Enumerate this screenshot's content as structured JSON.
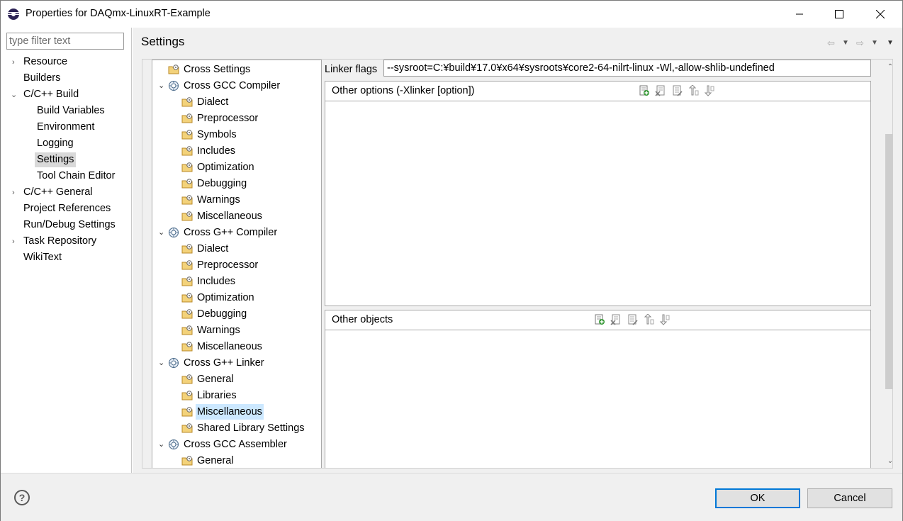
{
  "window": {
    "title": "Properties for DAQmx-LinuxRT-Example"
  },
  "filter": {
    "placeholder": "type filter text"
  },
  "nav": {
    "items": [
      {
        "label": "Resource"
      },
      {
        "label": "Builders"
      },
      {
        "label": "C/C++ Build"
      },
      {
        "label": "Build Variables"
      },
      {
        "label": "Environment"
      },
      {
        "label": "Logging"
      },
      {
        "label": "Settings",
        "selected": true
      },
      {
        "label": "Tool Chain Editor"
      },
      {
        "label": "C/C++ General"
      },
      {
        "label": "Project References"
      },
      {
        "label": "Run/Debug Settings"
      },
      {
        "label": "Task Repository"
      },
      {
        "label": "WikiText"
      }
    ]
  },
  "page": {
    "title": "Settings"
  },
  "tree": {
    "rows": [
      {
        "label": "Cross Settings",
        "icon": "folder-settings-icon"
      },
      {
        "label": "Cross GCC Compiler",
        "icon": "tool-gear-icon",
        "expanded": true
      },
      {
        "label": "Dialect",
        "icon": "folder-settings-icon"
      },
      {
        "label": "Preprocessor",
        "icon": "folder-settings-icon"
      },
      {
        "label": "Symbols",
        "icon": "folder-settings-icon"
      },
      {
        "label": "Includes",
        "icon": "folder-settings-icon"
      },
      {
        "label": "Optimization",
        "icon": "folder-settings-icon"
      },
      {
        "label": "Debugging",
        "icon": "folder-settings-icon"
      },
      {
        "label": "Warnings",
        "icon": "folder-settings-icon"
      },
      {
        "label": "Miscellaneous",
        "icon": "folder-settings-icon"
      },
      {
        "label": "Cross G++ Compiler",
        "icon": "tool-gear-icon",
        "expanded": true
      },
      {
        "label": "Dialect",
        "icon": "folder-settings-icon"
      },
      {
        "label": "Preprocessor",
        "icon": "folder-settings-icon"
      },
      {
        "label": "Includes",
        "icon": "folder-settings-icon"
      },
      {
        "label": "Optimization",
        "icon": "folder-settings-icon"
      },
      {
        "label": "Debugging",
        "icon": "folder-settings-icon"
      },
      {
        "label": "Warnings",
        "icon": "folder-settings-icon"
      },
      {
        "label": "Miscellaneous",
        "icon": "folder-settings-icon"
      },
      {
        "label": "Cross G++ Linker",
        "icon": "tool-gear-icon",
        "expanded": true
      },
      {
        "label": "General",
        "icon": "folder-settings-icon"
      },
      {
        "label": "Libraries",
        "icon": "folder-settings-icon"
      },
      {
        "label": "Miscellaneous",
        "icon": "folder-settings-icon",
        "selected": true
      },
      {
        "label": "Shared Library Settings",
        "icon": "folder-settings-icon"
      },
      {
        "label": "Cross GCC Assembler",
        "icon": "tool-gear-icon",
        "expanded": true
      },
      {
        "label": "General",
        "icon": "folder-settings-icon"
      }
    ]
  },
  "details": {
    "linker_flags_label": "Linker flags",
    "linker_flags_value": "--sysroot=C:¥build¥17.0¥x64¥sysroots¥core2-64-nilrt-linux -Wl,-allow-shlib-undefined",
    "other_options_title": "Other options (-Xlinker [option])",
    "other_objects_title": "Other objects"
  },
  "buttons": {
    "ok": "OK",
    "cancel": "Cancel"
  },
  "colors": {
    "selection_tree": "#cce8ff",
    "selection_nav": "#d9d9d9",
    "default_button_border": "#0078d7"
  }
}
